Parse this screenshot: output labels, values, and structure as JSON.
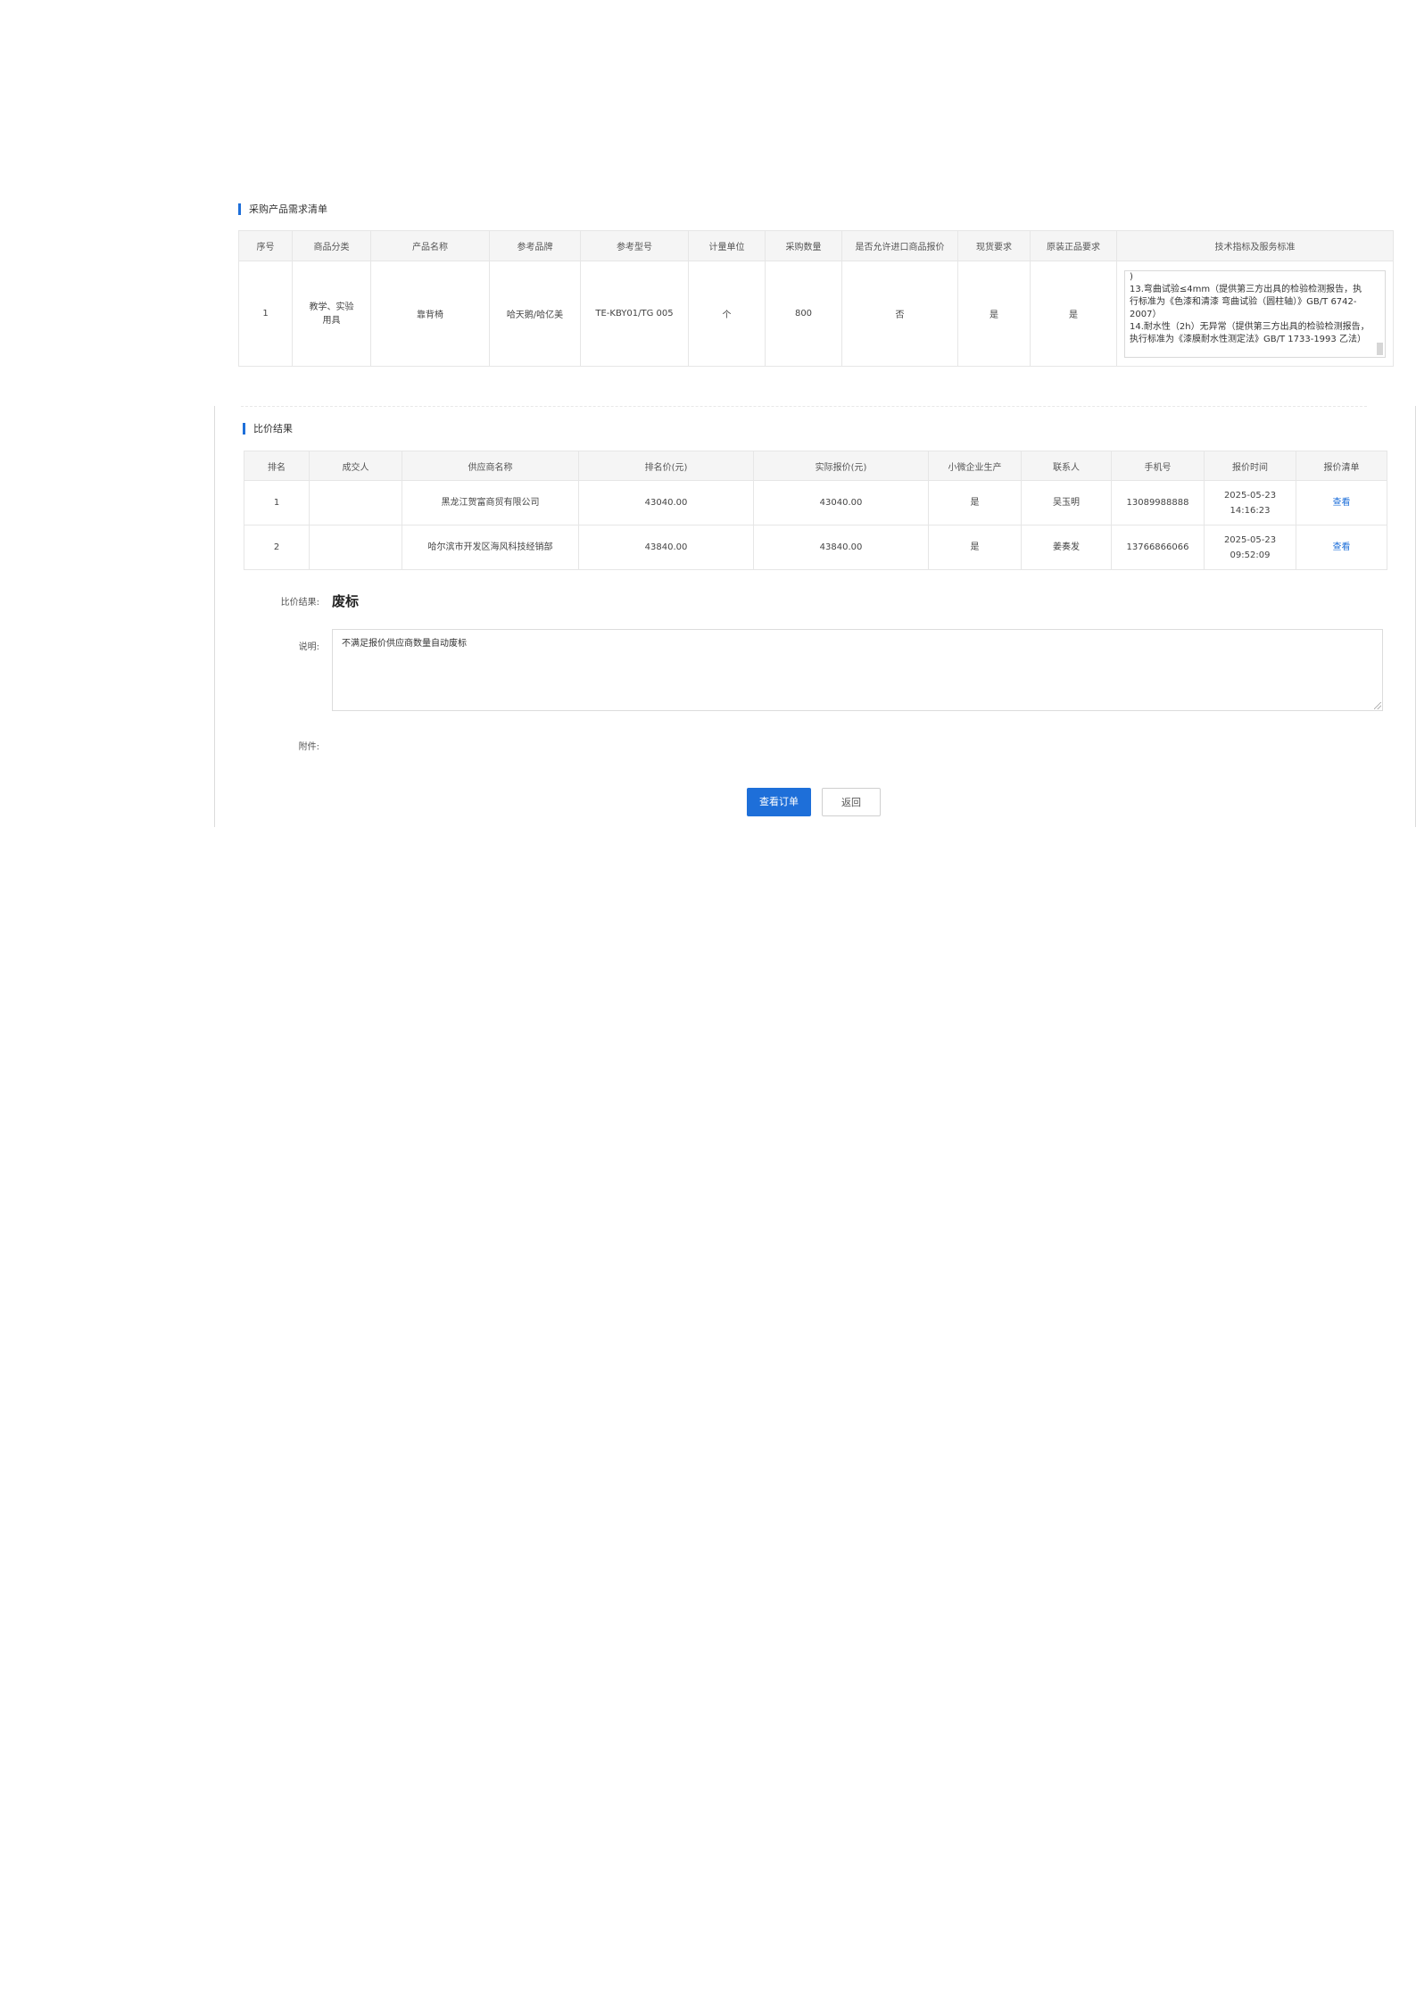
{
  "demand": {
    "title": "采购产品需求清单",
    "headers": [
      "序号",
      "商品分类",
      "产品名称",
      "参考品牌",
      "参考型号",
      "计量单位",
      "采购数量",
      "是否允许进口商品报价",
      "现货要求",
      "原装正品要求",
      "技术指标及服务标准"
    ],
    "row": {
      "index": "1",
      "category": "教学、实验\n用具",
      "product": "靠背椅",
      "brand": "哈天鹅/哈亿美",
      "model": "TE-KBY01/TG 005",
      "unit": "个",
      "quantity": "800",
      "import_allowed": "否",
      "stock_required": "是",
      "genuine_required": "是",
      "spec_lines": [
        ")",
        "13.弯曲试验≤4mm（提供第三方出具的检验检测报告，执行标准为《色漆和清漆 弯曲试验（圆柱轴）》GB/T 6742-2007）",
        "14.耐水性（2h）无异常（提供第三方出具的检验检测报告，执行标准为《漆膜耐水性测定法》GB/T 1733-1993 乙法）"
      ]
    }
  },
  "comparison": {
    "title": "比价结果",
    "headers": [
      "排名",
      "成交人",
      "供应商名称",
      "排名价(元)",
      "实际报价(元)",
      "小微企业生产",
      "联系人",
      "手机号",
      "报价时间",
      "报价清单"
    ],
    "rows": [
      {
        "rank": "1",
        "winner": "",
        "supplier": "黑龙江贺富商贸有限公司",
        "rank_price": "43040.00",
        "actual_price": "43040.00",
        "small_business": "是",
        "contact": "吴玉明",
        "phone": "13089988888",
        "date": "2025-05-23",
        "time": "14:16:23",
        "action": "查看"
      },
      {
        "rank": "2",
        "winner": "",
        "supplier": "哈尔滨市开发区海风科技经销部",
        "rank_price": "43840.00",
        "actual_price": "43840.00",
        "small_business": "是",
        "contact": "姜奏发",
        "phone": "13766866066",
        "date": "2025-05-23",
        "time": "09:52:09",
        "action": "查看"
      }
    ]
  },
  "form": {
    "result_label": "比价结果:",
    "result_value": "废标",
    "desc_label": "说明:",
    "desc_value": "不满足报价供应商数量自动废标",
    "attach_label": "附件:"
  },
  "buttons": {
    "view_order": "查看订单",
    "back": "返回"
  },
  "colors": {
    "accent": "#1e6fd9",
    "header_bg": "#f5f5f5",
    "border": "#e6e6e6"
  }
}
